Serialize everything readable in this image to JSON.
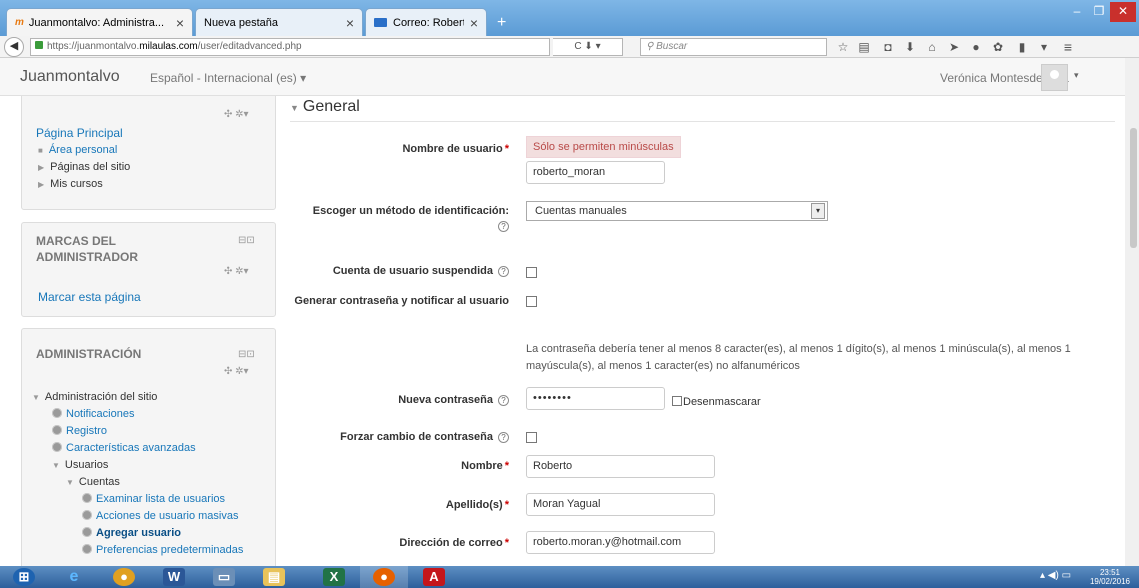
{
  "browser": {
    "tabs": [
      {
        "label": "Juanmontalvo: Administra...",
        "favicon": "m",
        "active": true
      },
      {
        "label": "Nueva pestaña",
        "active": false
      },
      {
        "label": "Correo: Roberto Moran - ...",
        "active": false
      }
    ],
    "new_tab_icon": "+",
    "window_controls": {
      "minimize": "–",
      "maximize": "❐",
      "close": "✕"
    },
    "url_prefix": "https://juanmontalvo.",
    "url_domain": "milaulas.com",
    "url_path": "/user/editadvanced.php",
    "url_tools": "C ⬇ ▾",
    "search_placeholder": "Buscar"
  },
  "header": {
    "brand": "Juanmontalvo",
    "language": "Español - Internacional (es) ▾",
    "user_name": "Verónica Montesdeocaa",
    "user_dropdown": "▾"
  },
  "sidebar": {
    "nav_block": {
      "controls": "✣ ✲▾",
      "home": "Página Principal",
      "items": [
        "Área personal",
        "Páginas del sitio",
        "Mis cursos"
      ]
    },
    "bookmarks_block": {
      "title": "MARCAS DEL ADMINISTRADOR",
      "dock": "⊟⊡",
      "controls": "✣ ✲▾",
      "link": "Marcar esta página"
    },
    "admin_block": {
      "title": "ADMINISTRACIÓN",
      "dock": "⊟⊡",
      "controls": "✣ ✲▾",
      "site_admin": "Administración del sitio",
      "notifications": "Notificaciones",
      "registration": "Registro",
      "advanced": "Características avanzadas",
      "users": "Usuarios",
      "accounts": "Cuentas",
      "browse_users": "Examinar lista de usuarios",
      "bulk_actions": "Acciones de usuario masivas",
      "add_user": "Agregar usuario",
      "default_prefs": "Preferencias predeterminadas"
    }
  },
  "form": {
    "legend": "General",
    "username_label": "Nombre de usuario",
    "username_error": "Sólo se permiten minúsculas",
    "username_value": "roberto_moran",
    "auth_label": "Escoger un método de identificación:",
    "auth_value": "Cuentas manuales",
    "suspended_label": "Cuenta de usuario suspendida",
    "generate_password_label": "Generar contraseña y notificar al usuario",
    "password_policy": "La contraseña debería tener al menos 8 caracter(es), al menos 1 dígito(s), al menos 1 minúscula(s), al menos 1 mayúscula(s), al menos 1 caracter(es) no alfanuméricos",
    "new_password_label": "Nueva contraseña",
    "new_password_value": "••••••••",
    "unmask_label": "Desenmascarar",
    "force_change_label": "Forzar cambio de contraseña",
    "firstname_label": "Nombre",
    "firstname_value": "Roberto",
    "lastname_label": "Apellido(s)",
    "lastname_value": "Moran Yagual",
    "email_label": "Dirección de correo",
    "email_value": "roberto.moran.y@hotmail.com",
    "required_marker": "*",
    "help_icon": "?"
  },
  "taskbar": {
    "time": "23:51",
    "date": "19/02/2016"
  },
  "colors": {
    "link": "#1877b9",
    "required": "#cc0000",
    "error_bg": "#f2dede",
    "titlebar": "#5b9bd5"
  }
}
